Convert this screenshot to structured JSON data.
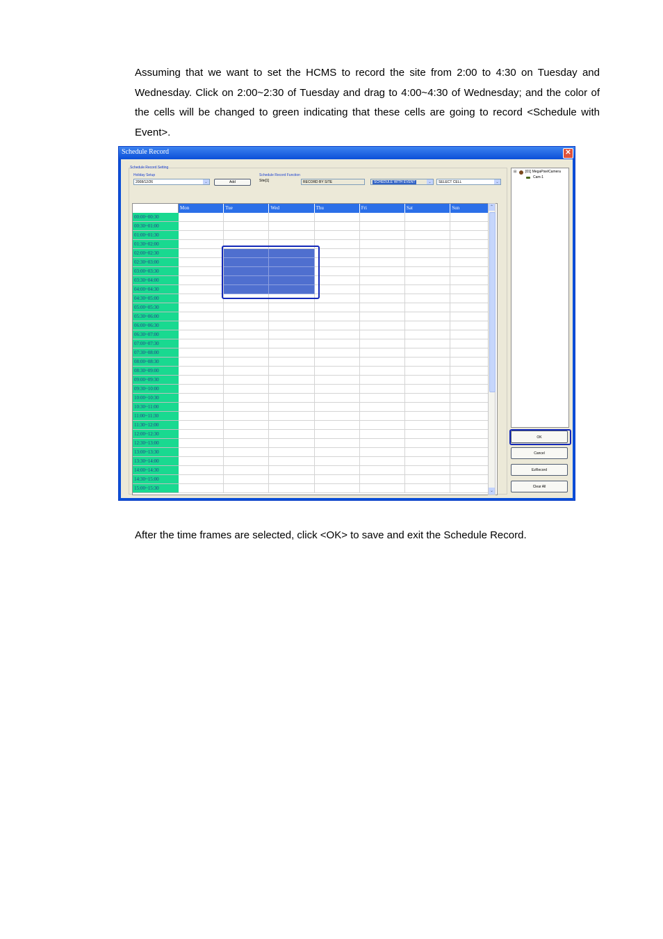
{
  "paragraph1": "Assuming that we want to set the HCMS to record the site from 2:00 to 4:30 on Tuesday and Wednesday. Click on 2:00~2:30 of Tuesday and drag to 4:00~4:30 of Wednesday; and the color of the cells will be changed to green indicating that these cells are going to record <Schedule with Event>.",
  "paragraph2": "After the time frames are selected, click <OK> to save and exit the Schedule Record.",
  "window": {
    "title": "Schedule Record",
    "close_glyph": "✕",
    "group_title": "Schedule Record Setting",
    "holiday_label": "Holiday Setup",
    "holiday_value": "2008/12/26",
    "add_label": "Add",
    "function_label": "Schedule Record Function",
    "site_text": "Site[1]",
    "record_by": "RECORD BY SITE",
    "schedule_mode": "SCHEDULE WITH EVENT",
    "select_mode": "SELECT CELL",
    "tree_root": "[01] MegaPixelCamera",
    "tree_child": "Cam-1",
    "buttons": {
      "ok": "OK",
      "cancel": "Cancel",
      "ezrecord": "EzRecord",
      "clear_all": "Clear All"
    },
    "days": [
      "Mon",
      "Tue",
      "Wed",
      "Thu",
      "Fri",
      "Sat",
      "Sun"
    ],
    "times": [
      "00:00~00:30",
      "00:30~01:00",
      "01:00~01:30",
      "01:30~02:00",
      "02:00~02:30",
      "02:30~03:00",
      "03:00~03:30",
      "03:30~04:00",
      "04:00~04:30",
      "04:30~05:00",
      "05:00~05:30",
      "05:30~06:00",
      "06:00~06:30",
      "06:30~07:00",
      "07:00~07:30",
      "07:30~08:00",
      "08:00~08:30",
      "08:30~09:00",
      "09:00~09:30",
      "09:30~10:00",
      "10:00~10:30",
      "10:30~11:00",
      "11:00~11:30",
      "11:30~12:00",
      "12:00~12:30",
      "12:30~13:00",
      "13:00~13:30",
      "13:30~14:00",
      "14:00~14:30",
      "14:30~15:00",
      "15:00~15:30"
    ],
    "selected": {
      "days": [
        "Tue",
        "Wed"
      ],
      "from": "02:00~02:30",
      "to": "04:00~04:30"
    }
  }
}
